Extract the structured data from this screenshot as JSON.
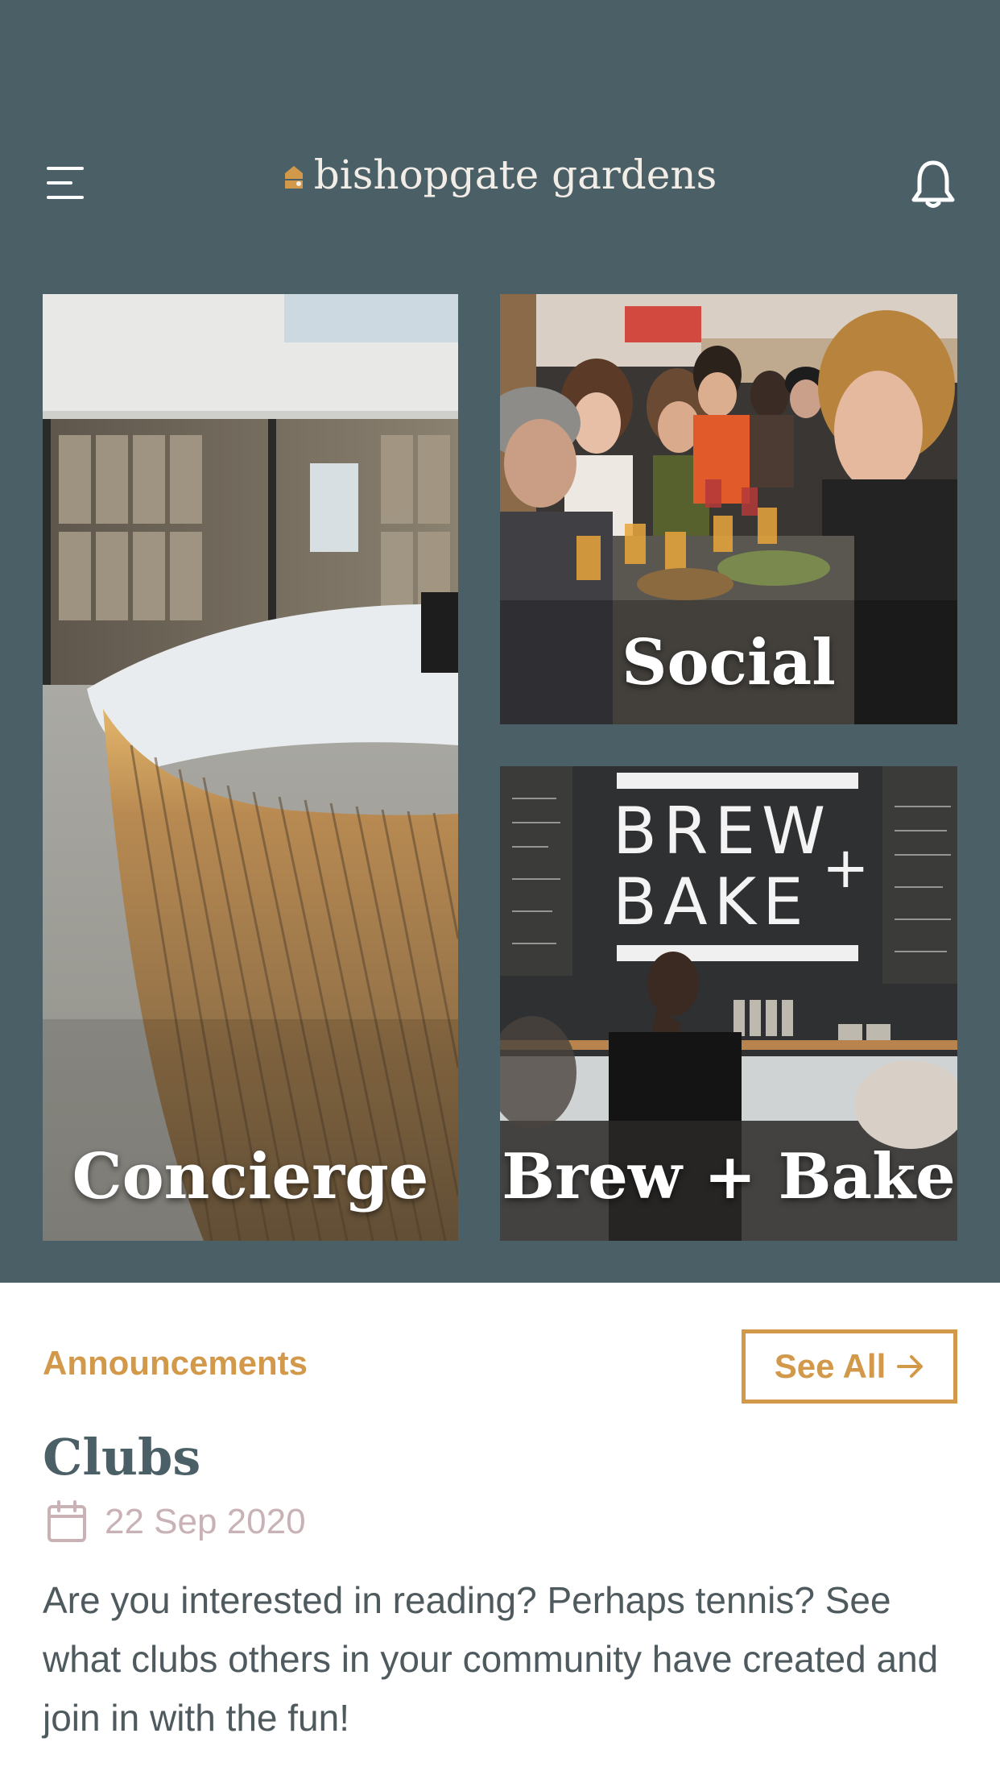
{
  "header": {
    "brand": "bishopgate gardens",
    "menu_icon": "hamburger-menu-icon",
    "notification_icon": "bell-icon"
  },
  "tiles": [
    {
      "label": "Concierge"
    },
    {
      "label": "Social"
    },
    {
      "label": "Brew + Bake"
    }
  ],
  "announcements": {
    "section_label": "Announcements",
    "see_all_label": "See All",
    "item": {
      "title": "Clubs",
      "date": "22 Sep 2020",
      "body": "Are you interested in reading? Perhaps tennis? See what clubs others in your community have created and join in with the fun!"
    }
  },
  "colors": {
    "header_bg": "#4a5f66",
    "accent": "#d2994a",
    "title": "#4a5f66",
    "date": "#c9b2b6"
  },
  "tile_photo_text": {
    "sign": "BREW BAKE"
  }
}
